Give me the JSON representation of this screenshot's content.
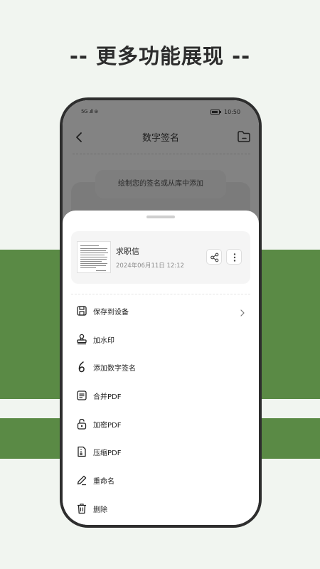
{
  "page": {
    "headline": "-- 更多功能展现 --",
    "colors": {
      "background": "#f1f5f0",
      "band": "#5a8a45",
      "phone_frame": "#2e2e2e"
    }
  },
  "statusbar": {
    "left_icons": "5G .ıll ⊛",
    "time": "10:50"
  },
  "nav": {
    "title": "数字签名",
    "back_icon": "chevron-left-icon",
    "folder_icon": "folder-icon"
  },
  "hint": "绘制您的签名或从库中添加",
  "document": {
    "title": "求职信",
    "date": "2024年06月11日  12:12",
    "share_icon": "share-icon",
    "more_icon": "more-vertical-icon"
  },
  "menu": [
    {
      "label": "保存到设备",
      "icon": "save-icon",
      "has_chevron": true
    },
    {
      "label": "加水印",
      "icon": "stamp-icon"
    },
    {
      "label": "添加数字签名",
      "icon": "signature-icon"
    },
    {
      "label": "合并PDF",
      "icon": "merge-pdf-icon"
    },
    {
      "label": "加密PDF",
      "icon": "lock-icon"
    },
    {
      "label": "压缩PDF",
      "icon": "compress-icon"
    },
    {
      "label": "重命名",
      "icon": "pencil-icon"
    },
    {
      "label": "删除",
      "icon": "trash-icon"
    }
  ]
}
